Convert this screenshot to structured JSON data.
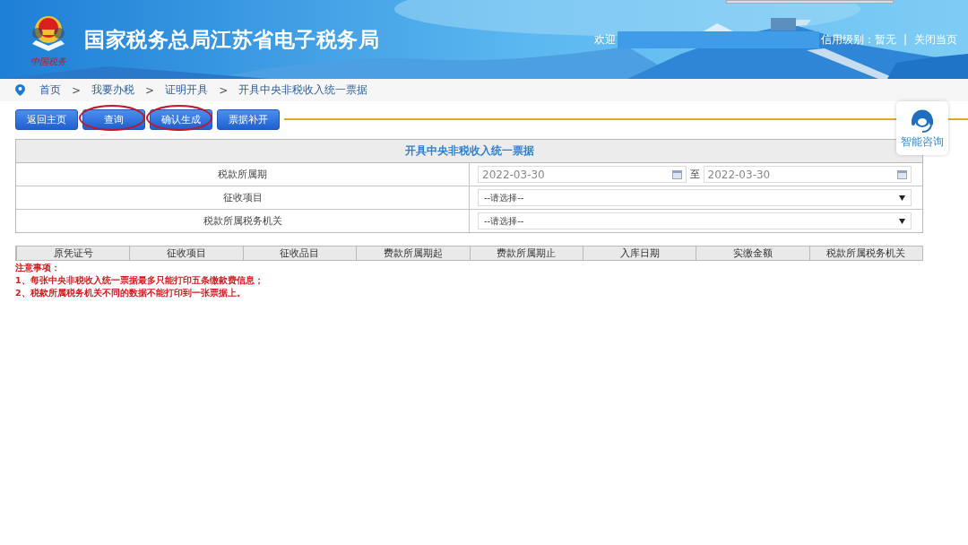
{
  "header": {
    "title": "国家税务总局江苏省电子税务局",
    "logo_caption": "中国税务",
    "welcome": "欢迎",
    "credit_label": "信用级别：暂无",
    "separator": "|",
    "close_link": "关闭当页"
  },
  "breadcrumb": [
    "首页",
    "我要办税",
    "证明开具",
    "开具中央非税收入统一票据"
  ],
  "breadcrumb_separator": ">",
  "toolbar": [
    {
      "label": "返回主页",
      "circled": false
    },
    {
      "label": "查询",
      "circled": true
    },
    {
      "label": "确认生成",
      "circled": true
    },
    {
      "label": "票据补开",
      "circled": false
    }
  ],
  "consult": {
    "label": "智能咨询"
  },
  "form": {
    "title": "开具中央非税收入统一票据",
    "rows": [
      {
        "kind": "daterange",
        "label": "税款所属期",
        "from": "2022-03-30",
        "to_label": "至",
        "to": "2022-03-30"
      },
      {
        "kind": "select",
        "label": "征收项目",
        "value": "--请选择--"
      },
      {
        "kind": "select",
        "label": "税款所属税务机关",
        "value": "--请选择--"
      }
    ]
  },
  "table": {
    "columns": [
      "原凭证号",
      "征收项目",
      "征收品目",
      "费款所属期起",
      "费款所属期止",
      "入库日期",
      "实缴金额",
      "税款所属税务机关"
    ]
  },
  "notes": {
    "title": "注意事项：",
    "items": [
      "1、每张中央非税收入统一票据最多只能打印五条缴款费信息；",
      "2、税款所属税务机关不同的数据不能打印到一张票据上。"
    ]
  }
}
